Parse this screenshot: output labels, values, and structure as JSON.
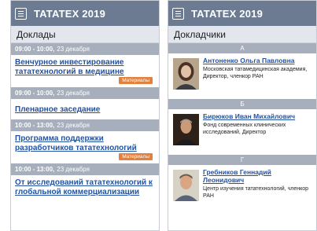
{
  "app_title": "TATATEX 2019",
  "left": {
    "section": "Доклады",
    "sessions": [
      {
        "time": "09:00 - 10:00,",
        "date": "23 декабря",
        "title": "Венчурное инвестирование тататехнологий в медицине",
        "tag": "Материалы"
      },
      {
        "time": "09:00 - 10:00,",
        "date": "23 декабря",
        "title": "Пленарное заседание",
        "tag": ""
      },
      {
        "time": "10:00 - 13:00,",
        "date": "23 декабря",
        "title": "Программа поддержки разработчиков тататехнологий",
        "tag": "Материалы"
      },
      {
        "time": "10:00 - 13:00,",
        "date": "23 декабря",
        "title": "От исследований тататехнологий к глобальной коммерциализации",
        "tag": ""
      }
    ]
  },
  "right": {
    "section": "Докладчики",
    "groups": [
      {
        "letter": "А",
        "name": "Антоненко Ольга Павловна",
        "org": "Московская татамедицинская академия, Директор, членкор РАН",
        "avatar_icon": "woman-portrait"
      },
      {
        "letter": "Б",
        "name": "Бирюков Иван Михайлович",
        "org": "Фонд современных клинических исследований, Директор",
        "avatar_icon": "man-portrait-dark"
      },
      {
        "letter": "Г",
        "name": "Гребников Геннадий Леонидович",
        "org": "Центр изучения тататехнологий, членкор РАН",
        "avatar_icon": "man-portrait-light"
      }
    ]
  }
}
